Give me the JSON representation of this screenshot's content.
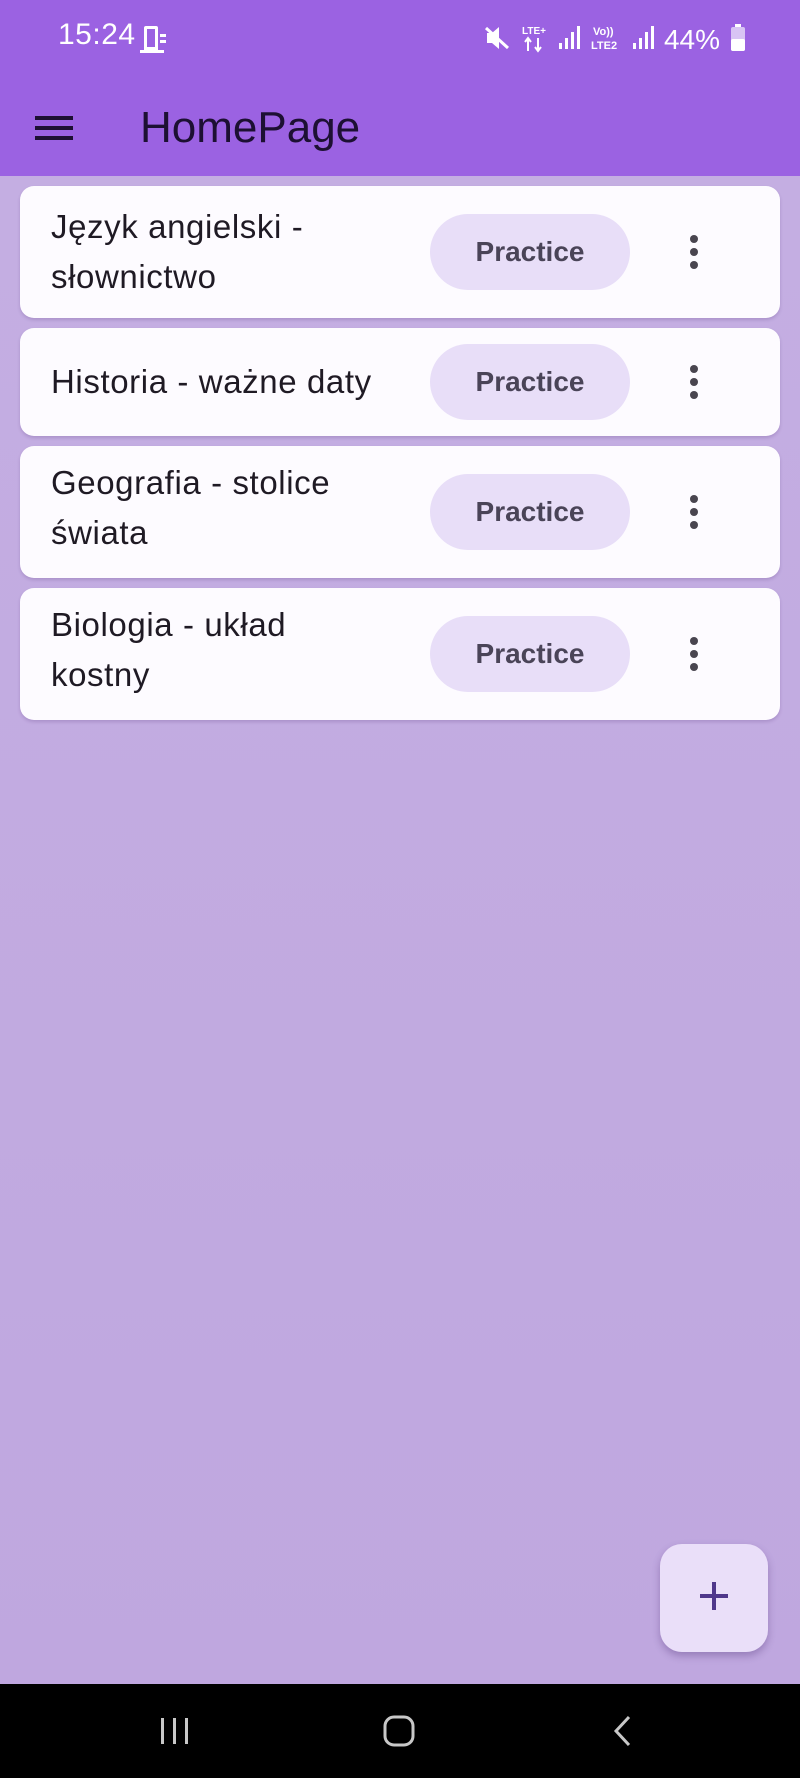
{
  "status_bar": {
    "time": "15:24",
    "battery": "44%",
    "network_label_1": "LTE+",
    "network_label_2": "Vo)) LTE2",
    "icons": [
      "screen-mirror-icon",
      "mute-icon",
      "lte-data-icon",
      "signal-icon",
      "volte-icon",
      "signal-icon",
      "battery-icon"
    ]
  },
  "app_bar": {
    "title": "HomePage",
    "menu_icon": "hamburger-menu-icon"
  },
  "decks": [
    {
      "title": "Język angielski - słownictwo",
      "practice_label": "Practice",
      "more_icon": "more-vert-icon"
    },
    {
      "title": "Historia - ważne daty",
      "practice_label": "Practice",
      "more_icon": "more-vert-icon"
    },
    {
      "title": "Geografia - stolice świata",
      "practice_label": "Practice",
      "more_icon": "more-vert-icon"
    },
    {
      "title": "Biologia - układ kostny",
      "practice_label": "Practice",
      "more_icon": "more-vert-icon"
    }
  ],
  "fab": {
    "icon": "plus-icon"
  },
  "nav_bar": {
    "icons": [
      "recent-apps-icon",
      "home-icon",
      "back-icon"
    ]
  },
  "colors": {
    "app_bar": "#9b62e2",
    "background": "#c1a8e0",
    "card": "#fdfbff",
    "button": "#e8def8",
    "button_text": "#4a4458",
    "fab": "#eadff9",
    "fab_icon": "#4f378b"
  }
}
